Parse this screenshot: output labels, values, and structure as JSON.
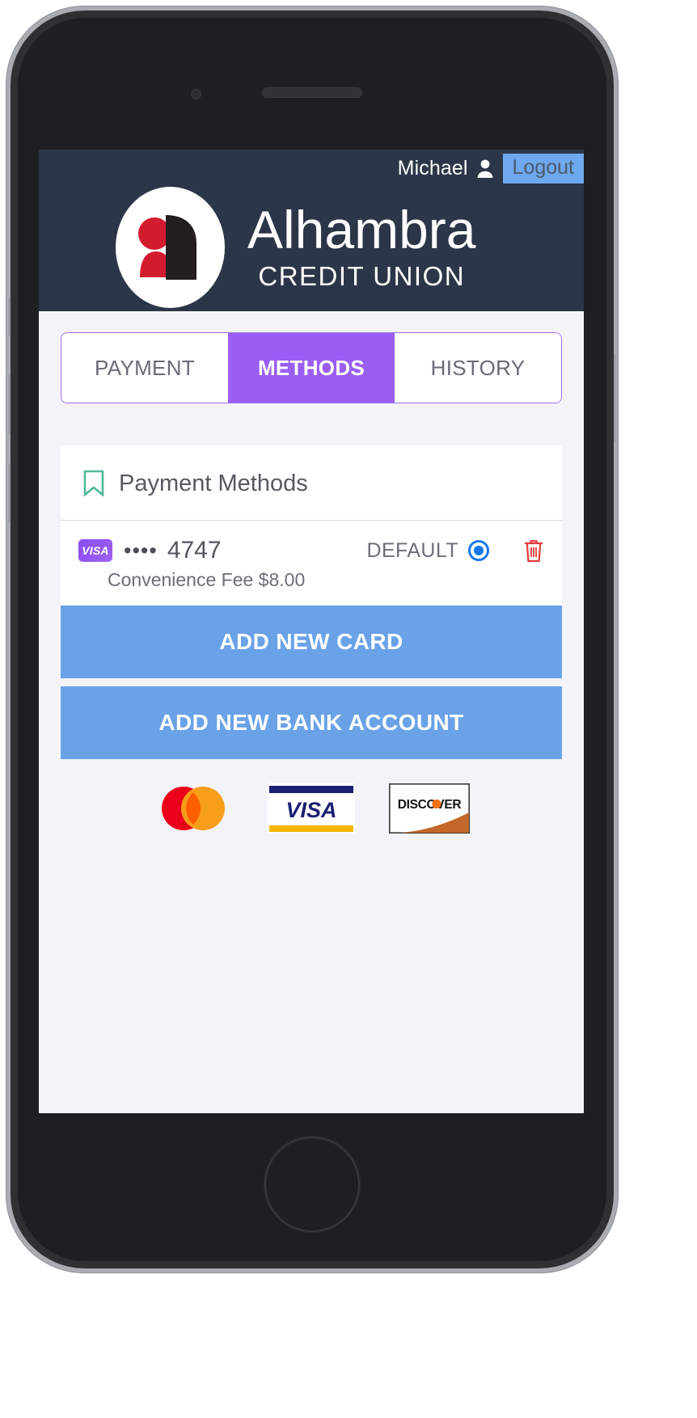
{
  "header": {
    "user_name": "Michael",
    "user_icon": "person-icon",
    "logout_label": "Logout",
    "brand_name": "Alhambra",
    "brand_subtitle": "CREDIT UNION",
    "background_color": "#2c3648",
    "logo_red": "#d31b2e",
    "logo_dark": "#231f20"
  },
  "tabs": [
    {
      "label": "PAYMENT",
      "active": false
    },
    {
      "label": "METHODS",
      "active": true
    },
    {
      "label": "HISTORY",
      "active": false
    }
  ],
  "tab_accent_color": "#9b5ef5",
  "panel": {
    "icon": "bookmark-icon",
    "icon_color": "#4eb99a",
    "title": "Payment Methods"
  },
  "payment_method": {
    "brand": "VISA",
    "mask_dots": "••••",
    "last4": "4747",
    "default_label": "DEFAULT",
    "is_default": true,
    "radio_color": "#1578e8",
    "delete_icon": "trash-icon",
    "delete_icon_color": "#e03a3a",
    "fee_text": "Convenience Fee $8.00"
  },
  "actions": {
    "add_card_label": "ADD NEW CARD",
    "add_bank_label": "ADD NEW BANK ACCOUNT",
    "button_color": "#6aa2e8"
  },
  "accepted_brands": [
    {
      "name": "mastercard-logo"
    },
    {
      "name": "visa-logo",
      "text": "VISA"
    },
    {
      "name": "discover-logo",
      "text": "DISCOVER"
    }
  ]
}
